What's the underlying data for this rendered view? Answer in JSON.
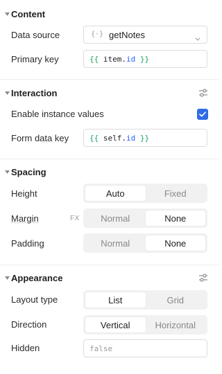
{
  "colors": {
    "accent": "#2f6be6",
    "segment_bg": "#f1f1f1",
    "code_brace": "#1aa260",
    "code_prop": "#2962ff"
  },
  "content": {
    "title": "Content",
    "data_source": {
      "label": "Data source",
      "icon_glyph": "{·}",
      "value": "getNotes"
    },
    "primary_key": {
      "label": "Primary key",
      "open": "{{",
      "ident": "item",
      "dot": ".",
      "prop": "id",
      "close": "}}"
    }
  },
  "interaction": {
    "title": "Interaction",
    "enable_instance_values": {
      "label": "Enable instance values",
      "checked": true
    },
    "form_data_key": {
      "label": "Form data key",
      "open": "{{",
      "ident": "self",
      "dot": ".",
      "prop": "id",
      "close": "}}"
    }
  },
  "spacing": {
    "title": "Spacing",
    "height": {
      "label": "Height",
      "options": [
        "Auto",
        "Fixed"
      ],
      "selected": "Auto"
    },
    "margin": {
      "label": "Margin",
      "fx": "FX",
      "options": [
        "Normal",
        "None"
      ],
      "selected": "None"
    },
    "padding": {
      "label": "Padding",
      "options": [
        "Normal",
        "None"
      ],
      "selected": "None"
    }
  },
  "appearance": {
    "title": "Appearance",
    "layout_type": {
      "label": "Layout type",
      "options": [
        "List",
        "Grid"
      ],
      "selected": "List"
    },
    "direction": {
      "label": "Direction",
      "options": [
        "Vertical",
        "Horizontal"
      ],
      "selected": "Vertical"
    },
    "hidden": {
      "label": "Hidden",
      "placeholder": "false"
    }
  }
}
